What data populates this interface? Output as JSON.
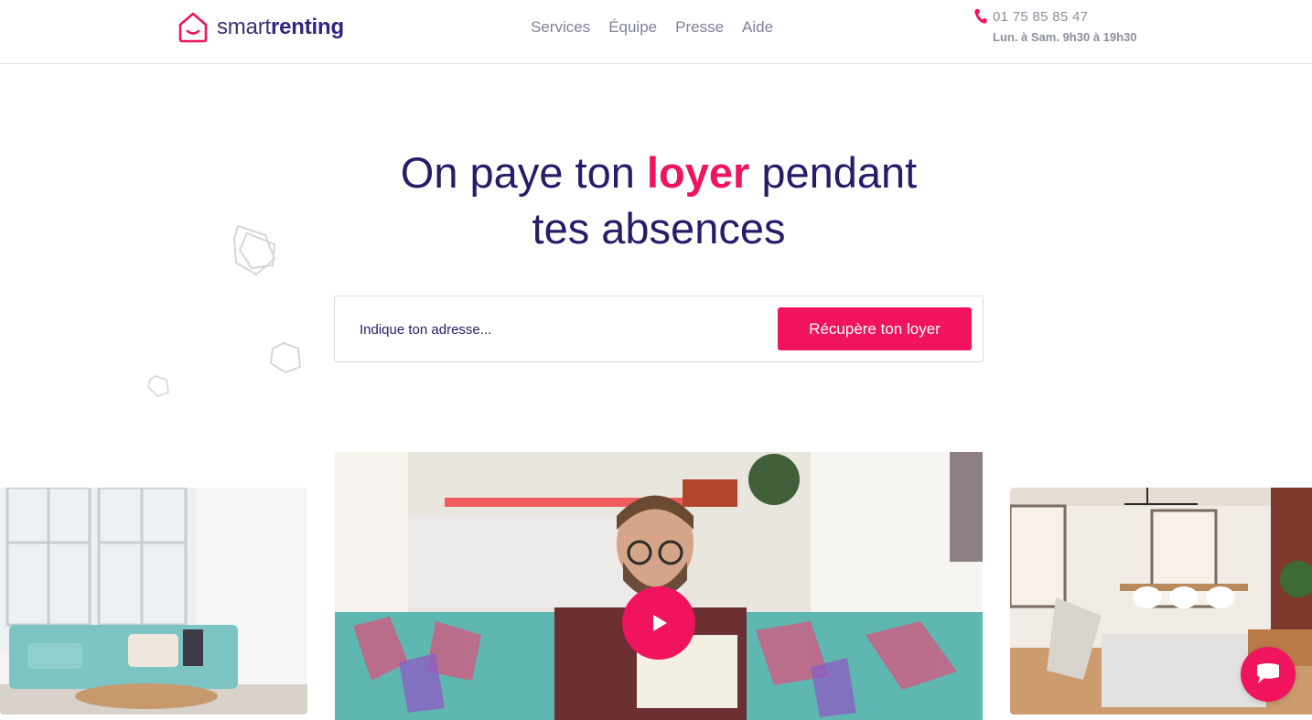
{
  "brand": {
    "name_light": "smart",
    "name_bold": "renting",
    "accent_color": "#f0135d",
    "primary_color": "#2a1a68"
  },
  "nav": {
    "items": [
      {
        "label": "Services"
      },
      {
        "label": "Équipe"
      },
      {
        "label": "Presse"
      },
      {
        "label": "Aide"
      }
    ]
  },
  "contact": {
    "icon": "phone-icon",
    "phone": "01 75 85 85 47",
    "hours": "Lun. à Sam. 9h30 à 19h30"
  },
  "hero": {
    "title_before": "On paye ton ",
    "title_accent": "loyer",
    "title_after_line1": " pendant",
    "title_line2": "tes absences"
  },
  "search": {
    "placeholder": "Indique ton adresse...",
    "value": "",
    "button_label": "Récupère ton loyer"
  },
  "media": {
    "left_photo": "living-room-teal-sofa",
    "video": "man-reading-on-patchwork-sofa",
    "right_photo": "loft-dining-room",
    "play_icon": "play-icon",
    "chat_icon": "chat-bubble-icon"
  }
}
